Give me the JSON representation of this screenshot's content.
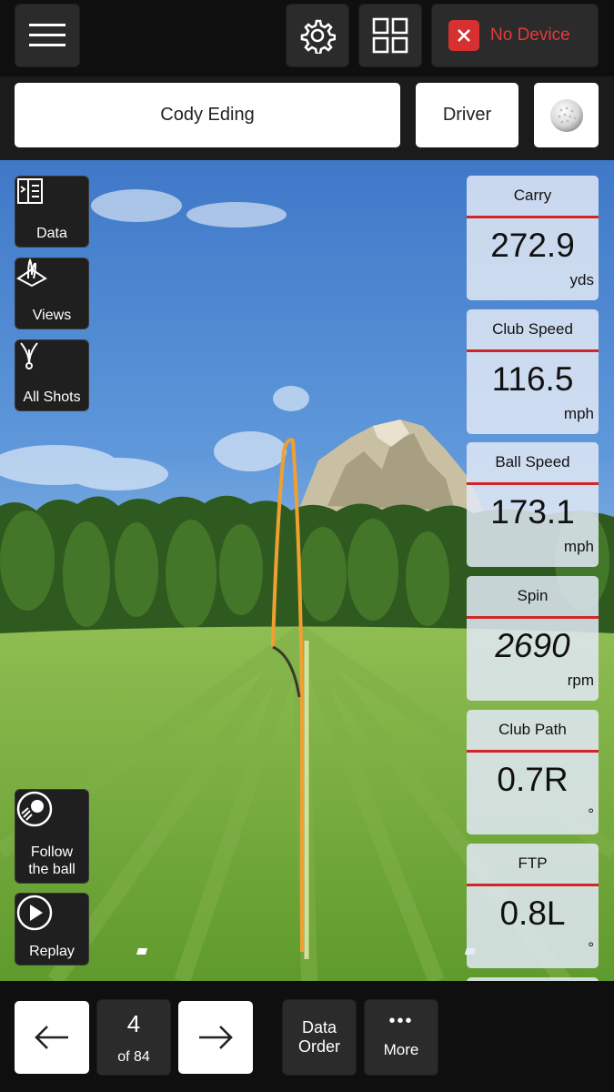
{
  "topbar": {
    "menu_icon": "hamburger-icon",
    "settings_icon": "gear-icon",
    "grid_icon": "grid-icon",
    "device_label": "No Device",
    "device_icon": "close-icon"
  },
  "player": {
    "name": "Cody Eding",
    "club": "Driver",
    "ball_icon": "golf-ball-icon"
  },
  "tools": {
    "data_label": "Data",
    "views_label": "Views",
    "all_shots_label": "All Shots",
    "follow_label_1": "Follow",
    "follow_label_2": "the ball",
    "replay_label": "Replay"
  },
  "stats": [
    {
      "title": "Carry",
      "value": "272.9",
      "unit": "yds"
    },
    {
      "title": "Club Speed",
      "value": "116.5",
      "unit": "mph"
    },
    {
      "title": "Ball Speed",
      "value": "173.1",
      "unit": "mph"
    },
    {
      "title": "Spin",
      "value": "2690",
      "unit": "rpm"
    },
    {
      "title": "Club Path",
      "value": "0.7R",
      "unit": "°"
    },
    {
      "title": "FTP",
      "value": "0.8L",
      "unit": "°"
    }
  ],
  "bottombar": {
    "shot_number": "4",
    "shot_total": "of 84",
    "data_order_1": "Data",
    "data_order_2": "Order",
    "more_dots": "•••",
    "more_label": "More"
  },
  "colors": {
    "shot_trace": "#f0a030",
    "accent_red": "#d32525"
  }
}
